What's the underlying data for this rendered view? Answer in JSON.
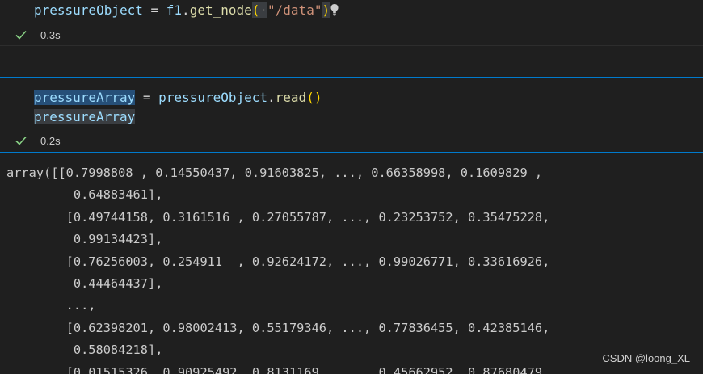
{
  "cell1": {
    "var": "pressureObject",
    "op": "=",
    "obj": "f1",
    "method": "get_node",
    "arg": "\"/data\"",
    "status_time": "0.3s"
  },
  "cell2": {
    "line1_var": "pressureArray",
    "line1_op": "=",
    "line1_obj": "pressureObject",
    "line1_method": "read",
    "line2_var": "pressureArray",
    "status_time": "0.2s"
  },
  "output": {
    "lines": [
      "array([[0.7998808 , 0.14550437, 0.91603825, ..., 0.66358998, 0.1609829 ,",
      "         0.64883461],",
      "        [0.49744158, 0.3161516 , 0.27055787, ..., 0.23253752, 0.35475228,",
      "         0.99134423],",
      "        [0.76256003, 0.254911  , 0.92624172, ..., 0.99026771, 0.33616926,",
      "         0.44464437],",
      "        ...,",
      "        [0.62398201, 0.98002413, 0.55179346, ..., 0.77836455, 0.42385146,",
      "         0.58084218],",
      "        [0.01515326, 0.90925492, 0.8131169 , ..., 0.45662952, 0.87680479,"
    ]
  },
  "watermark": "CSDN @loong_XL",
  "colors": {
    "background": "#1f1f1f",
    "cell_border_active": "#007acc",
    "variable": "#9cdcfe",
    "function": "#dcdcaa",
    "string": "#ce9178",
    "bracket": "#ffd700",
    "success_check": "#89d185"
  }
}
